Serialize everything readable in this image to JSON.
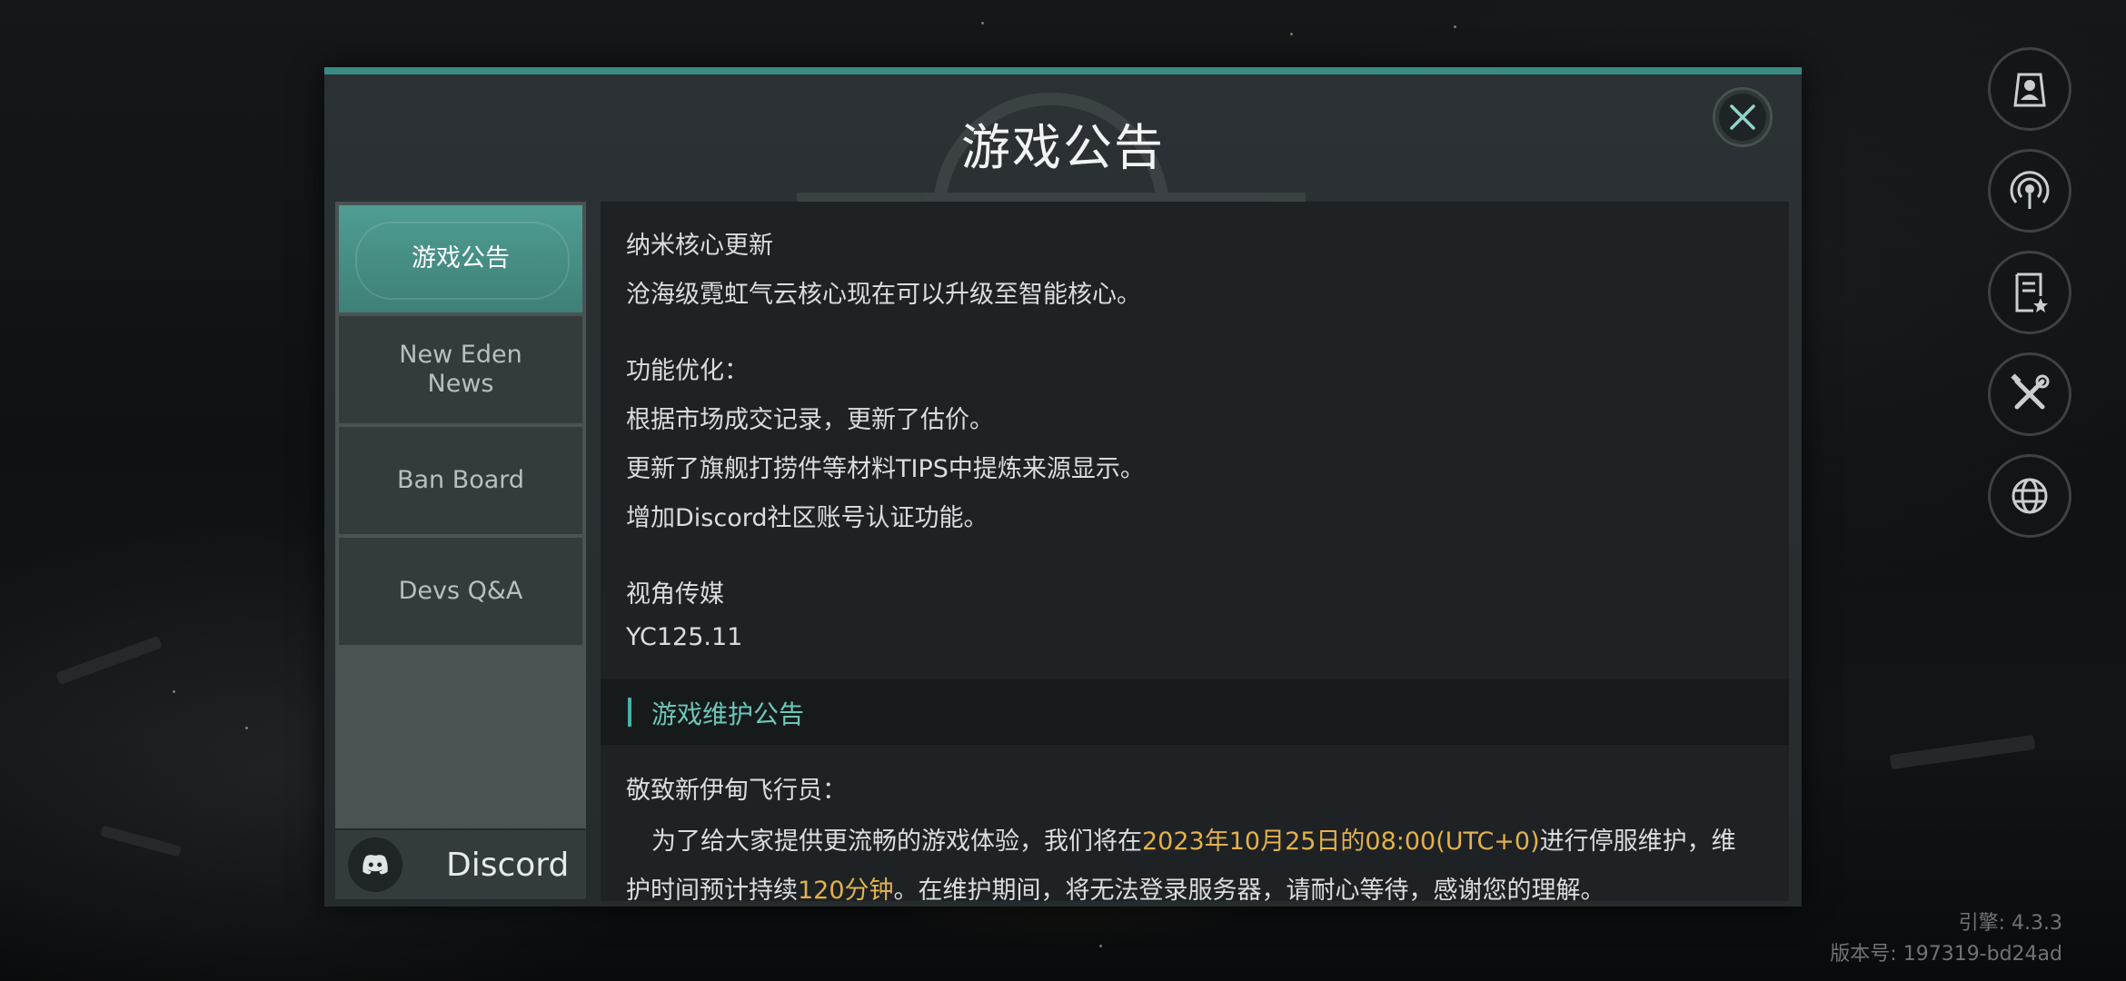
{
  "dialog": {
    "title": "游戏公告",
    "close_icon": "close-icon"
  },
  "sidebar": {
    "tabs": [
      {
        "label": "游戏公告",
        "active": true
      },
      {
        "label": "New Eden\nNews",
        "active": false
      },
      {
        "label": "Ban Board",
        "active": false
      },
      {
        "label": "Devs Q&A",
        "active": false
      }
    ],
    "discord": {
      "label": "Discord",
      "icon": "discord-icon"
    }
  },
  "content": {
    "update_title": "纳米核心更新",
    "update_text": "沧海级霓虹气云核心现在可以升级至智能核心。",
    "opt_heading": "功能优化：",
    "opt_items": [
      "根据市场成交记录，更新了估价。",
      "更新了旗舰打捞件等材料TIPS中提炼来源显示。",
      "增加Discord社区账号认证功能。"
    ],
    "media_heading": "视角传媒",
    "media_version": "YC125.11",
    "maintenance_header": "游戏维护公告",
    "greeting": "敬致新伊甸飞行员：",
    "notice_line1_a": "为了给大家提供更流畅的游戏体验，我们将在",
    "notice_line1_date": "2023年10月25日的08:00(UTC+0)",
    "notice_line1_b": "进行停服维护，维",
    "notice_line2_a": "护时间预计持续",
    "notice_line2_duration": "120分钟",
    "notice_line2_b": "。在维护期间，将无法登录服务器，请耐心等待，感谢您的理解。"
  },
  "right_buttons": [
    {
      "icon": "profile-icon"
    },
    {
      "icon": "broadcast-icon"
    },
    {
      "icon": "document-star-icon"
    },
    {
      "icon": "tools-icon"
    },
    {
      "icon": "globe-icon"
    }
  ],
  "footer": {
    "engine": "引擎: 4.3.3",
    "build": "版本号: 197319-bd24ad"
  },
  "colors": {
    "accent_teal": "#3a8b82",
    "highlight_orange": "#e3b14f",
    "section_teal": "#6ec5b8"
  }
}
